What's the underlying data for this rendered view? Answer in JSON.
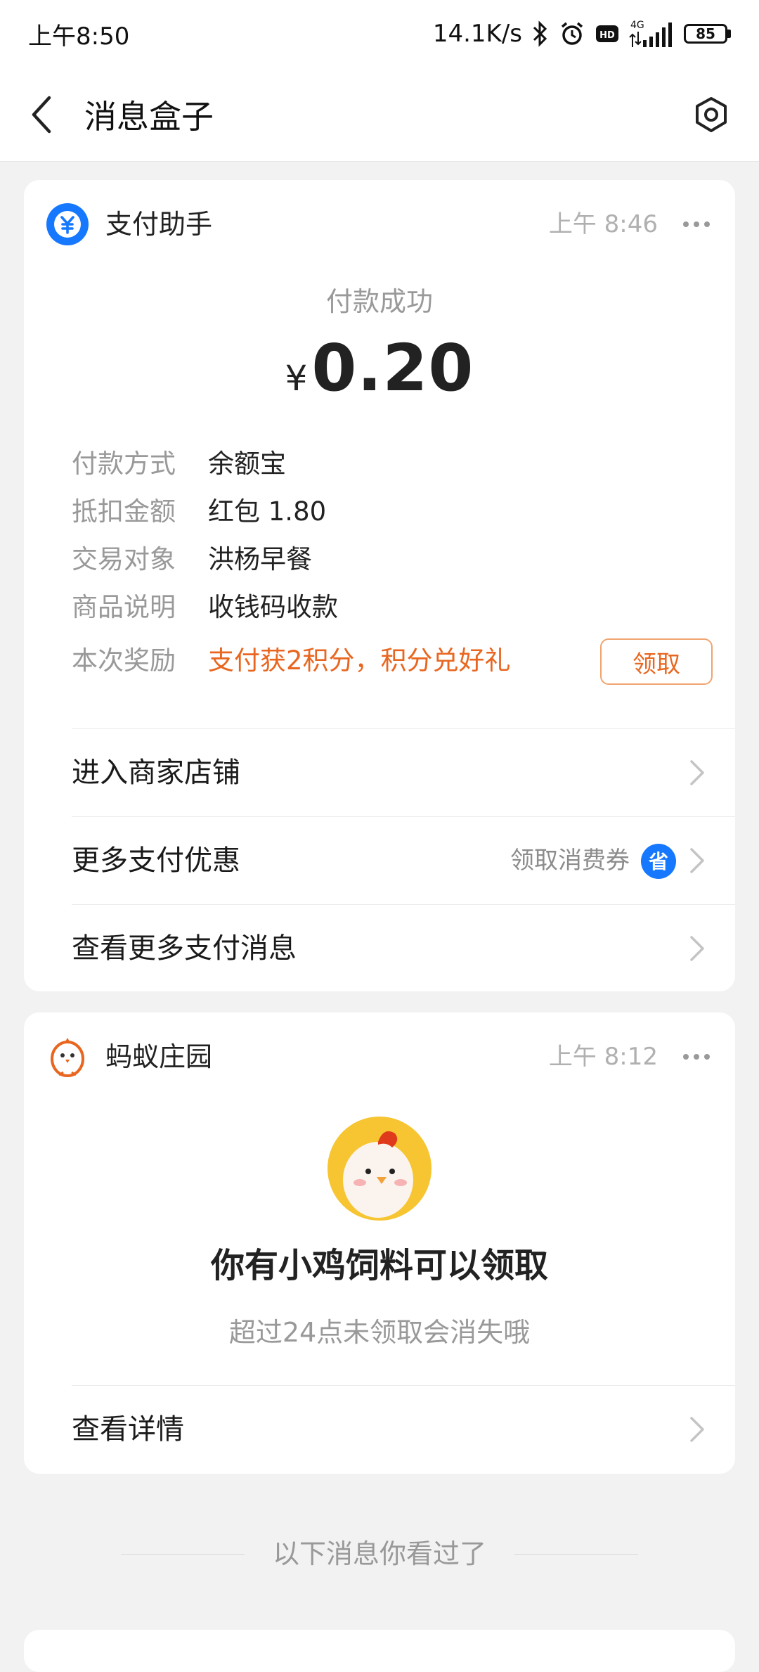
{
  "status_bar": {
    "time": "上午8:50",
    "net_speed": "14.1K/s",
    "net_type": "4G",
    "battery": "85",
    "icons": [
      "bluetooth-icon",
      "alarm-icon",
      "hd-icon",
      "signal-icon",
      "battery-icon"
    ]
  },
  "header": {
    "title": "消息盒子",
    "back_icon": "chevron-left-icon",
    "settings_icon": "gear-icon"
  },
  "payment_card": {
    "app_name": "支付助手",
    "app_icon": "yuan-icon",
    "time": "上午 8:46",
    "status": "付款成功",
    "currency": "¥",
    "amount": "0.20",
    "details": [
      {
        "key": "付款方式",
        "value": "余额宝"
      },
      {
        "key": "抵扣金额",
        "value": "红包 1.80"
      },
      {
        "key": "交易对象",
        "value": "洪杨早餐"
      },
      {
        "key": "商品说明",
        "value": "收钱码收款"
      },
      {
        "key": "本次奖励",
        "value": "支付获2积分，积分兑好礼"
      }
    ],
    "claim_label": "领取",
    "links": [
      {
        "label": "进入商家店铺"
      },
      {
        "label": "更多支付优惠",
        "hint": "领取消费券",
        "hint_icon": "sheng-coupon-icon"
      },
      {
        "label": "查看更多支付消息"
      }
    ]
  },
  "farm_card": {
    "app_name": "蚂蚁庄园",
    "app_icon": "chick-icon",
    "time": "上午 8:12",
    "title": "你有小鸡饲料可以领取",
    "subtitle": "超过24点未领取会消失哦",
    "link": "查看详情"
  },
  "seen_divider": "以下消息你看过了",
  "colors": {
    "accent_blue": "#1677ff",
    "accent_orange": "#e8661f",
    "background": "#f2f2f2"
  }
}
